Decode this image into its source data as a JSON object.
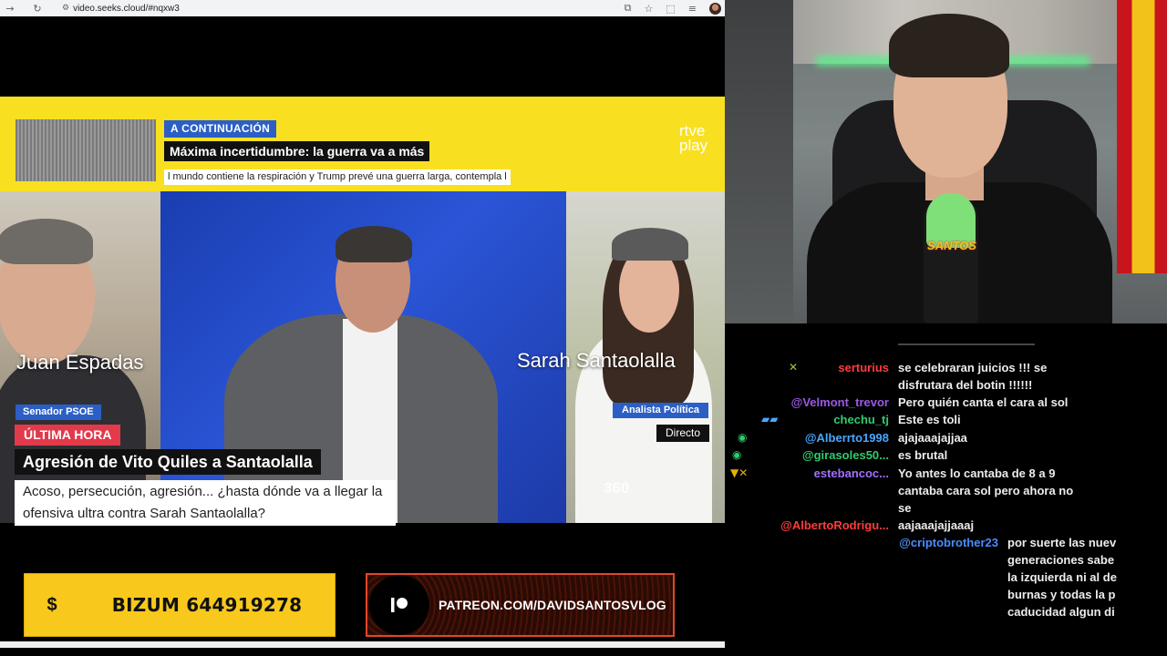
{
  "browser": {
    "url": "video.seeks.cloud/#nqxw3",
    "back_icon": "arrow-left-icon",
    "reload_icon": "reload-icon"
  },
  "video": {
    "up_next_tag": "A CONTINUACIÓN",
    "up_next_title": "Máxima incertidumbre: la guerra va a más",
    "ticker": "l mundo contiene la respiración y Trump prevé una guerra larga, contempla l",
    "logo_line1": "rtve",
    "logo_line2": "play",
    "left_name": "Juan Espadas",
    "left_role": "Senador PSOE",
    "right_name": "Sarah Santaolalla",
    "right_role": "Analista Política",
    "live_label": "Directo",
    "breaking_label": "ÚLTIMA HORA",
    "headline": "Agresión de Vito Quiles a Santaolalla",
    "subheadline": "Acoso, persecución, agresión... ¿hasta dónde va a llegar la ofensiva ultra contra Sarah Santaolalla?",
    "channel_logo": "360"
  },
  "banners": {
    "bizum_symbol": "$",
    "bizum_text": "BIZUM 644919278",
    "patreon_text": "PATREON.COM/DAVIDSANTOSVLOG"
  },
  "webcam": {
    "mic_label": "SANTOS"
  },
  "chat": {
    "messages": [
      {
        "user": "serturius",
        "color": "#ff3b3b",
        "badge": "✕",
        "badge_color": "#9acd32",
        "text_lines": [
          "se celebraran juicios !!! se",
          "disfrutara del botin !!!!!!"
        ]
      },
      {
        "user": "@Velmont_trevor",
        "color": "#9b59e6",
        "badge": "",
        "badge_color": "",
        "text_lines": [
          "Pero quién canta el cara al sol"
        ]
      },
      {
        "user": "chechu_tj",
        "color": "#2ecc71",
        "badge": "▰▰",
        "badge_color": "#4aa8ff",
        "text_lines": [
          "Este es toli"
        ]
      },
      {
        "user": "@Alberrto1998",
        "color": "#4aa8ff",
        "badge": "◉",
        "badge_color": "#2ecc71",
        "text_lines": [
          "ajajaaajajjaa"
        ]
      },
      {
        "user": "@girasoles50...",
        "color": "#2ecc71",
        "badge": "◉",
        "badge_color": "#2ecc71",
        "text_lines": [
          "es brutal"
        ]
      },
      {
        "user": "estebancoc...",
        "color": "#a070ff",
        "badge": "▼✕",
        "badge_color": "#e3b000",
        "text_lines": [
          "Yo antes lo cantaba de 8 a 9",
          "cantaba cara sol pero ahora no",
          "se"
        ]
      },
      {
        "user": "@AlbertoRodrigu...",
        "color": "#ff3b3b",
        "badge": "",
        "badge_color": "",
        "text_lines": [
          "aajaaajajjaaaj"
        ]
      },
      {
        "user": "@criptobrother23",
        "color": "#4a8cff",
        "badge": "",
        "badge_color": "",
        "text_lines": [
          "por suerte las nuev",
          "generaciones sabe",
          "la izquierda ni al de",
          "burnas y todas la p",
          "caducidad algun di"
        ]
      }
    ]
  }
}
